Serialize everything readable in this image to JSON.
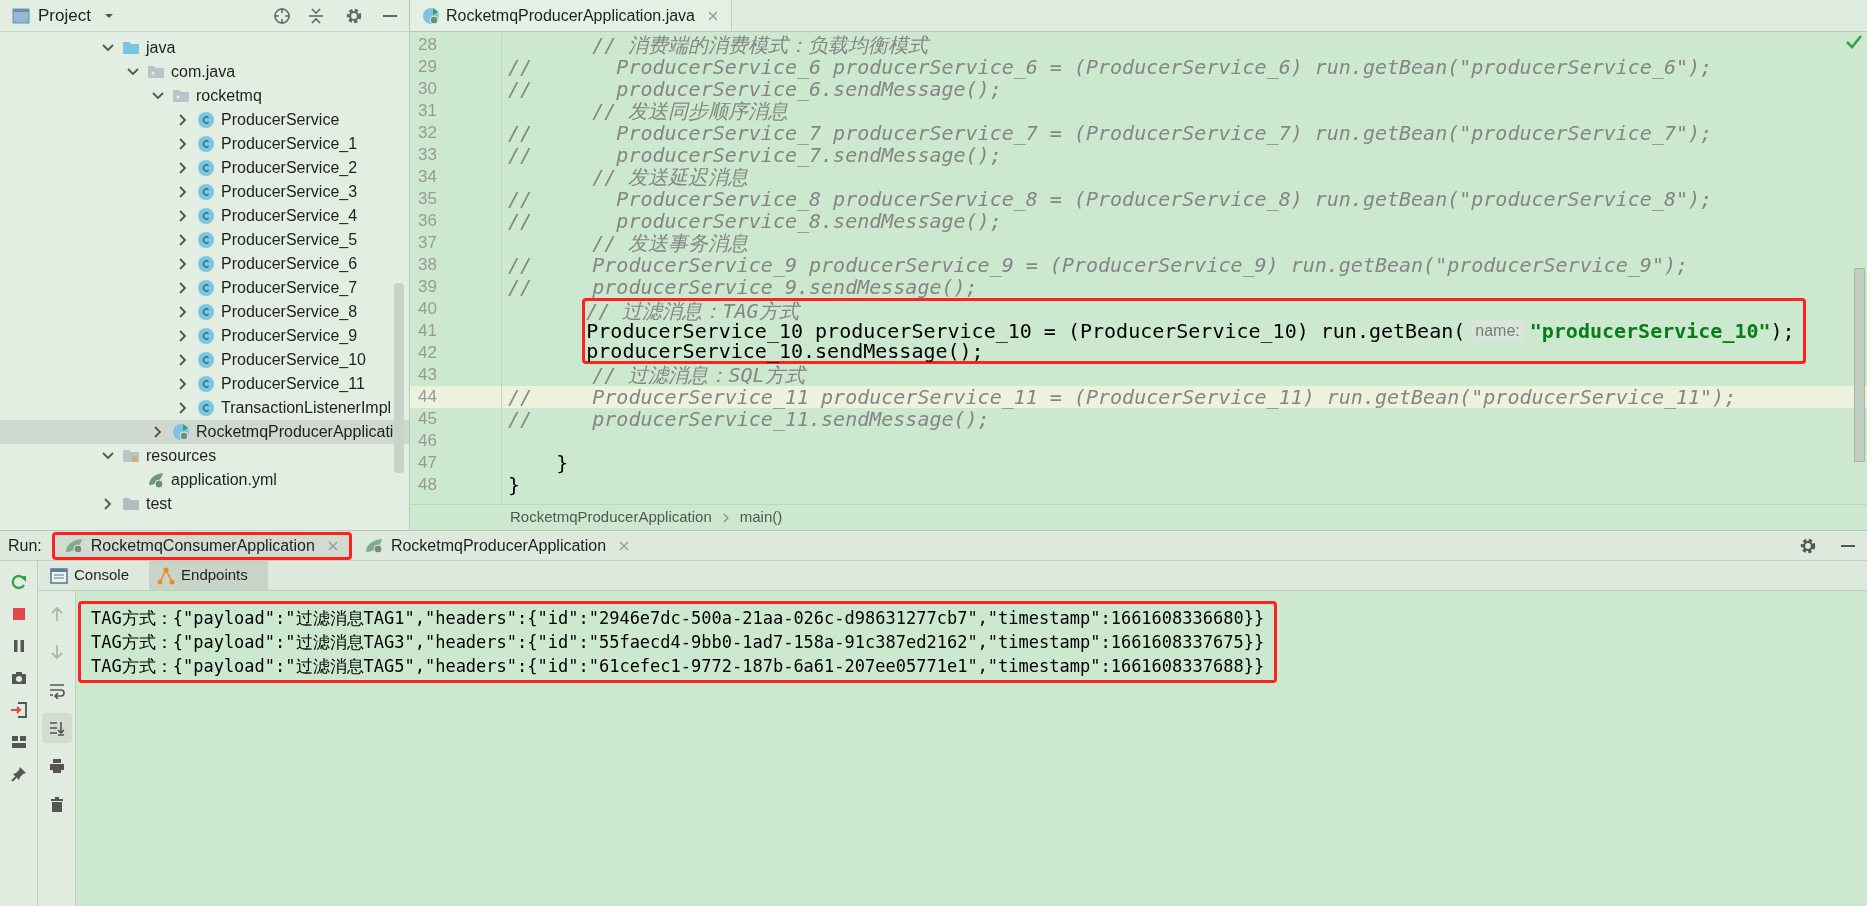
{
  "project": {
    "title": "Project",
    "tree": [
      {
        "label": "java",
        "kind": "source-folder",
        "expanded": true,
        "selected": false,
        "children": [
          {
            "label": "com.java",
            "kind": "package",
            "expanded": true,
            "selected": false,
            "children": [
              {
                "label": "rocketmq",
                "kind": "package",
                "expanded": true,
                "selected": false,
                "children": [
                  {
                    "label": "ProducerService",
                    "kind": "class",
                    "expanded": false,
                    "selected": false
                  },
                  {
                    "label": "ProducerService_1",
                    "kind": "class",
                    "expanded": false,
                    "selected": false
                  },
                  {
                    "label": "ProducerService_2",
                    "kind": "class",
                    "expanded": false,
                    "selected": false
                  },
                  {
                    "label": "ProducerService_3",
                    "kind": "class",
                    "expanded": false,
                    "selected": false
                  },
                  {
                    "label": "ProducerService_4",
                    "kind": "class",
                    "expanded": false,
                    "selected": false
                  },
                  {
                    "label": "ProducerService_5",
                    "kind": "class",
                    "expanded": false,
                    "selected": false
                  },
                  {
                    "label": "ProducerService_6",
                    "kind": "class",
                    "expanded": false,
                    "selected": false
                  },
                  {
                    "label": "ProducerService_7",
                    "kind": "class",
                    "expanded": false,
                    "selected": false
                  },
                  {
                    "label": "ProducerService_8",
                    "kind": "class",
                    "expanded": false,
                    "selected": false
                  },
                  {
                    "label": "ProducerService_9",
                    "kind": "class",
                    "expanded": false,
                    "selected": false
                  },
                  {
                    "label": "ProducerService_10",
                    "kind": "class",
                    "expanded": false,
                    "selected": false
                  },
                  {
                    "label": "ProducerService_11",
                    "kind": "class",
                    "expanded": false,
                    "selected": false
                  },
                  {
                    "label": "TransactionListenerImpl",
                    "kind": "class",
                    "expanded": false,
                    "selected": false
                  }
                ]
              },
              {
                "label": "RocketmqProducerApplicati",
                "kind": "spring-class",
                "expanded": false,
                "selected": true
              }
            ]
          }
        ]
      },
      {
        "label": "resources",
        "kind": "resources-folder",
        "expanded": true,
        "selected": false,
        "children": [
          {
            "label": "application.yml",
            "kind": "yml",
            "selected": false
          }
        ]
      },
      {
        "label": "test",
        "kind": "folder",
        "expanded": false,
        "selected": false
      }
    ]
  },
  "editor": {
    "tab": {
      "label": "RocketmqProducerApplication.java"
    },
    "lines": [
      {
        "number": "28",
        "segments": [
          {
            "kind": "comment",
            "text": "       // 消费端的消费模式：负载均衡模式"
          }
        ]
      },
      {
        "number": "29",
        "segments": [
          {
            "kind": "comment",
            "text": "//       ProducerService_6 producerService_6 = (ProducerService_6) run.getBean(\"producerService_6\");"
          }
        ]
      },
      {
        "number": "30",
        "segments": [
          {
            "kind": "comment",
            "text": "//       producerService_6.sendMessage();"
          }
        ]
      },
      {
        "number": "31",
        "segments": [
          {
            "kind": "comment",
            "text": "       // 发送同步顺序消息"
          }
        ]
      },
      {
        "number": "32",
        "segments": [
          {
            "kind": "comment",
            "text": "//       ProducerService_7 producerService_7 = (ProducerService_7) run.getBean(\"producerService_7\");"
          }
        ]
      },
      {
        "number": "33",
        "segments": [
          {
            "kind": "comment",
            "text": "//       producerService_7.sendMessage();"
          }
        ]
      },
      {
        "number": "34",
        "segments": [
          {
            "kind": "comment",
            "text": "       // 发送延迟消息"
          }
        ]
      },
      {
        "number": "35",
        "segments": [
          {
            "kind": "comment",
            "text": "//       ProducerService_8 producerService_8 = (ProducerService_8) run.getBean(\"producerService_8\");"
          }
        ]
      },
      {
        "number": "36",
        "segments": [
          {
            "kind": "comment",
            "text": "//       producerService_8.sendMessage();"
          }
        ]
      },
      {
        "number": "37",
        "segments": [
          {
            "kind": "comment",
            "text": "       // 发送事务消息"
          }
        ]
      },
      {
        "number": "38",
        "segments": [
          {
            "kind": "comment",
            "text": "//     ProducerService_9 producerService_9 = (ProducerService_9) run.getBean(\"producerService_9\");"
          }
        ]
      },
      {
        "number": "39",
        "segments": [
          {
            "kind": "comment",
            "text": "//     producerService_9.sendMessage();"
          }
        ]
      },
      {
        "number": "40",
        "boxed": true,
        "segments": [
          {
            "kind": "comment",
            "text": "       // 过滤消息：TAG方式"
          }
        ]
      },
      {
        "number": "41",
        "boxed": true,
        "segments": [
          {
            "kind": "code",
            "text": "       ProducerService_10 producerService_10 = (ProducerService_10) run.getBean("
          },
          {
            "kind": "hint",
            "text": "name:"
          },
          {
            "kind": "string",
            "text": "\"producerService_10\""
          },
          {
            "kind": "code",
            "text": ");"
          }
        ]
      },
      {
        "number": "42",
        "boxed": true,
        "segments": [
          {
            "kind": "code",
            "text": "       producerService_10.sendMessage();"
          }
        ]
      },
      {
        "number": "43",
        "segments": [
          {
            "kind": "comment",
            "text": "       // 过滤消息：SQL方式"
          }
        ]
      },
      {
        "number": "44",
        "current": true,
        "segments": [
          {
            "kind": "comment",
            "text": "//     ProducerService_11 producerService_11 = (ProducerService_11) run.getBean(\"producerService_11\");"
          }
        ]
      },
      {
        "number": "45",
        "segments": [
          {
            "kind": "comment",
            "text": "//     producerService_11.sendMessage();"
          }
        ]
      },
      {
        "number": "46"
      },
      {
        "number": "47",
        "segments": [
          {
            "kind": "code",
            "text": "    }"
          }
        ]
      },
      {
        "number": "48",
        "segments": [
          {
            "kind": "code",
            "text": "}"
          }
        ]
      }
    ],
    "breadcrumb": [
      "RocketmqProducerApplication",
      "main()"
    ]
  },
  "run": {
    "label": "Run:",
    "tabs": [
      {
        "label": "RocketmqConsumerApplication",
        "selected": true,
        "boxed": true
      },
      {
        "label": "RocketmqProducerApplication",
        "selected": false,
        "boxed": false
      }
    ],
    "subtabs": [
      {
        "label": "Console",
        "kind": "console",
        "selected": false
      },
      {
        "label": "Endpoints",
        "kind": "endpoints",
        "selected": true
      }
    ],
    "console_tools": [
      {
        "kind": "up",
        "on": false,
        "disabled": true
      },
      {
        "kind": "down",
        "on": false,
        "disabled": true
      },
      {
        "kind": "wrap",
        "on": false,
        "disabled": false
      },
      {
        "kind": "scroll-end",
        "on": true,
        "disabled": false
      },
      {
        "kind": "print",
        "on": false,
        "disabled": false
      },
      {
        "kind": "clear",
        "on": false,
        "disabled": false
      }
    ],
    "console": [
      {
        "text": "TAG方式：{\"payload\":\"过滤消息TAG1\",\"headers\":{\"id\":\"2946e7dc-500a-21aa-026c-d98631277cb7\",\"timestamp\":1661608336680}}",
        "boxed": true
      },
      {
        "text": "TAG方式：{\"payload\":\"过滤消息TAG3\",\"headers\":{\"id\":\"55faecd4-9bb0-1ad7-158a-91c387ed2162\",\"timestamp\":1661608337675}}",
        "boxed": true
      },
      {
        "text": "TAG方式：{\"payload\":\"过滤消息TAG5\",\"headers\":{\"id\":\"61cefec1-9772-187b-6a61-207ee05771e1\",\"timestamp\":1661608337688}}",
        "boxed": true
      }
    ]
  }
}
